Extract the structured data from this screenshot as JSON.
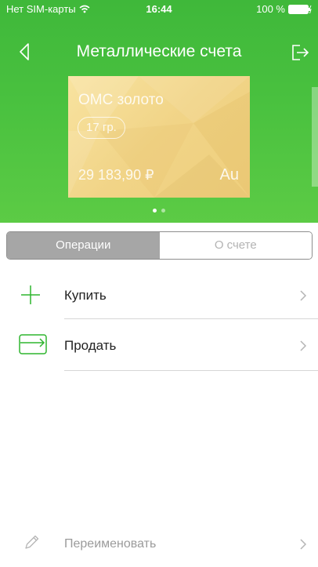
{
  "status_bar": {
    "carrier": "Нет SIM-карты",
    "time": "16:44",
    "battery": "100 %"
  },
  "nav": {
    "title": "Металлические счета",
    "back_icon": "back-chevron-icon",
    "logout_icon": "logout-icon"
  },
  "card": {
    "name": "ОМС золото",
    "weight": "17 гр.",
    "amount": "29 183,90 ₽",
    "symbol": "Au"
  },
  "pager": {
    "count": 2,
    "active": 0
  },
  "tabs": [
    {
      "label": "Операции",
      "active": true
    },
    {
      "label": "О счете",
      "active": false
    }
  ],
  "actions": {
    "buy": {
      "label": "Купить",
      "icon": "plus-icon"
    },
    "sell": {
      "label": "Продать",
      "icon": "sell-icon"
    },
    "rename": {
      "label": "Переименовать",
      "icon": "pencil-icon"
    }
  },
  "colors": {
    "brand_green": "#49c13f",
    "icon_green": "#2fb52f",
    "gold_card": "#f1d487",
    "segment_active": "#a6a6a6"
  }
}
